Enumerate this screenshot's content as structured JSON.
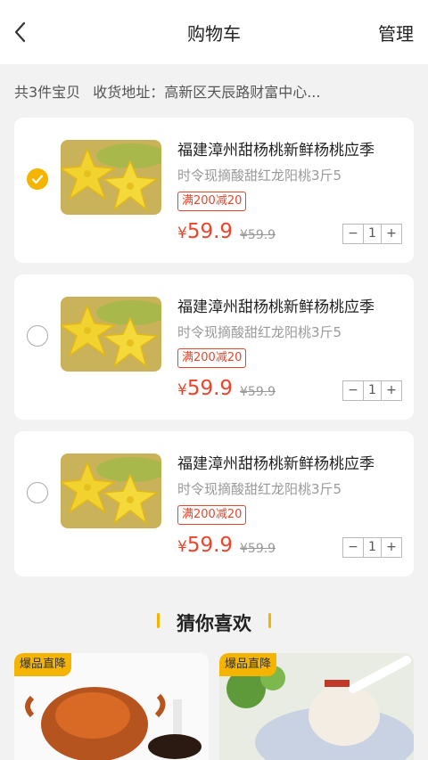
{
  "header": {
    "title": "购物车",
    "manage_label": "管理"
  },
  "summary": {
    "count_text": "共3件宝贝",
    "address_label": "收货地址：",
    "address_value": "高新区天辰路财富中心..."
  },
  "cart": {
    "items": [
      {
        "title": "福建漳州甜杨桃新鲜杨桃应季",
        "subtitle": "时令现摘酸甜红龙阳桃3斤5",
        "promo": "满200减20",
        "currency": "¥",
        "price": "59.9",
        "original_price": "¥59.9",
        "qty": "1",
        "minus": "−",
        "plus": "+",
        "selected": true
      },
      {
        "title": "福建漳州甜杨桃新鲜杨桃应季",
        "subtitle": "时令现摘酸甜红龙阳桃3斤5",
        "promo": "满200减20",
        "currency": "¥",
        "price": "59.9",
        "original_price": "¥59.9",
        "qty": "1",
        "minus": "−",
        "plus": "+",
        "selected": false
      },
      {
        "title": "福建漳州甜杨桃新鲜杨桃应季",
        "subtitle": "时令现摘酸甜红龙阳桃3斤5",
        "promo": "满200减20",
        "currency": "¥",
        "price": "59.9",
        "original_price": "¥59.9",
        "qty": "1",
        "minus": "−",
        "plus": "+",
        "selected": false
      }
    ]
  },
  "recommend": {
    "title": "猜你喜欢",
    "items": [
      {
        "badge": "爆品直降",
        "image": "crab-photo"
      },
      {
        "badge": "爆品直降",
        "image": "dessert-photo"
      }
    ]
  },
  "colors": {
    "accent": "#f4b400",
    "price": "#e8452c",
    "background": "#f2f2f2"
  },
  "icons": {
    "back": "chevron-left-icon",
    "check": "checkmark-icon"
  }
}
